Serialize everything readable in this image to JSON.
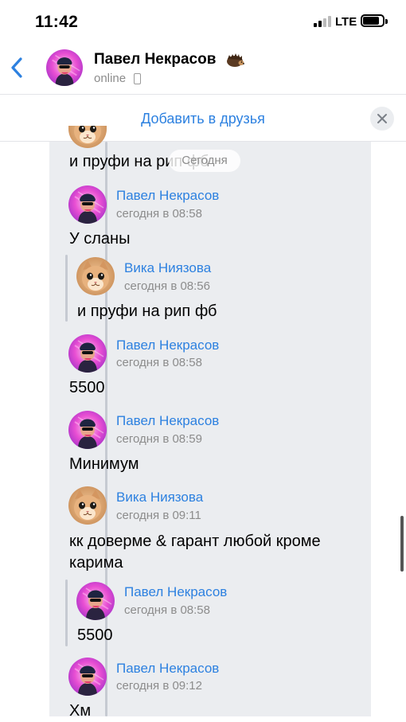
{
  "status_bar": {
    "time": "11:42",
    "network": "LTE",
    "battery_level": 0.75,
    "signal_bars_active": 2
  },
  "header": {
    "name": "Павел Некрасов",
    "status": "online",
    "emoji_icon": "hedgehog-icon"
  },
  "friend_bar": {
    "label": "Добавить в друзья"
  },
  "date_pill": "Сегодня",
  "messages": [
    {
      "text": "и пруфи на рип фб"
    },
    {
      "name": "Павел Некрасов",
      "time": "сегодня в 08:58",
      "text": "У сланы"
    },
    {
      "name": "Вика Ниязова",
      "time": "сегодня в 08:56",
      "text": "и пруфи на рип фб"
    },
    {
      "name": "Павел Некрасов",
      "time": "сегодня в 08:58",
      "text": "5500"
    },
    {
      "name": "Павел Некрасов",
      "time": "сегодня в 08:59",
      "text": "Минимум"
    },
    {
      "name": "Вика Ниязова",
      "time": "сегодня в 09:11",
      "text": "кк доверме & гарант любой кроме",
      "text2": "карима"
    },
    {
      "name": "Павел Некрасов",
      "time": "сегодня в 08:58",
      "text": "5500"
    },
    {
      "name": "Павел Некрасов",
      "time": "сегодня в 09:12",
      "text": "Хм"
    }
  ],
  "colors": {
    "accent": "#2d81e0",
    "chat_background": "#ebedf0",
    "secondary_text": "#8c8c8c"
  }
}
